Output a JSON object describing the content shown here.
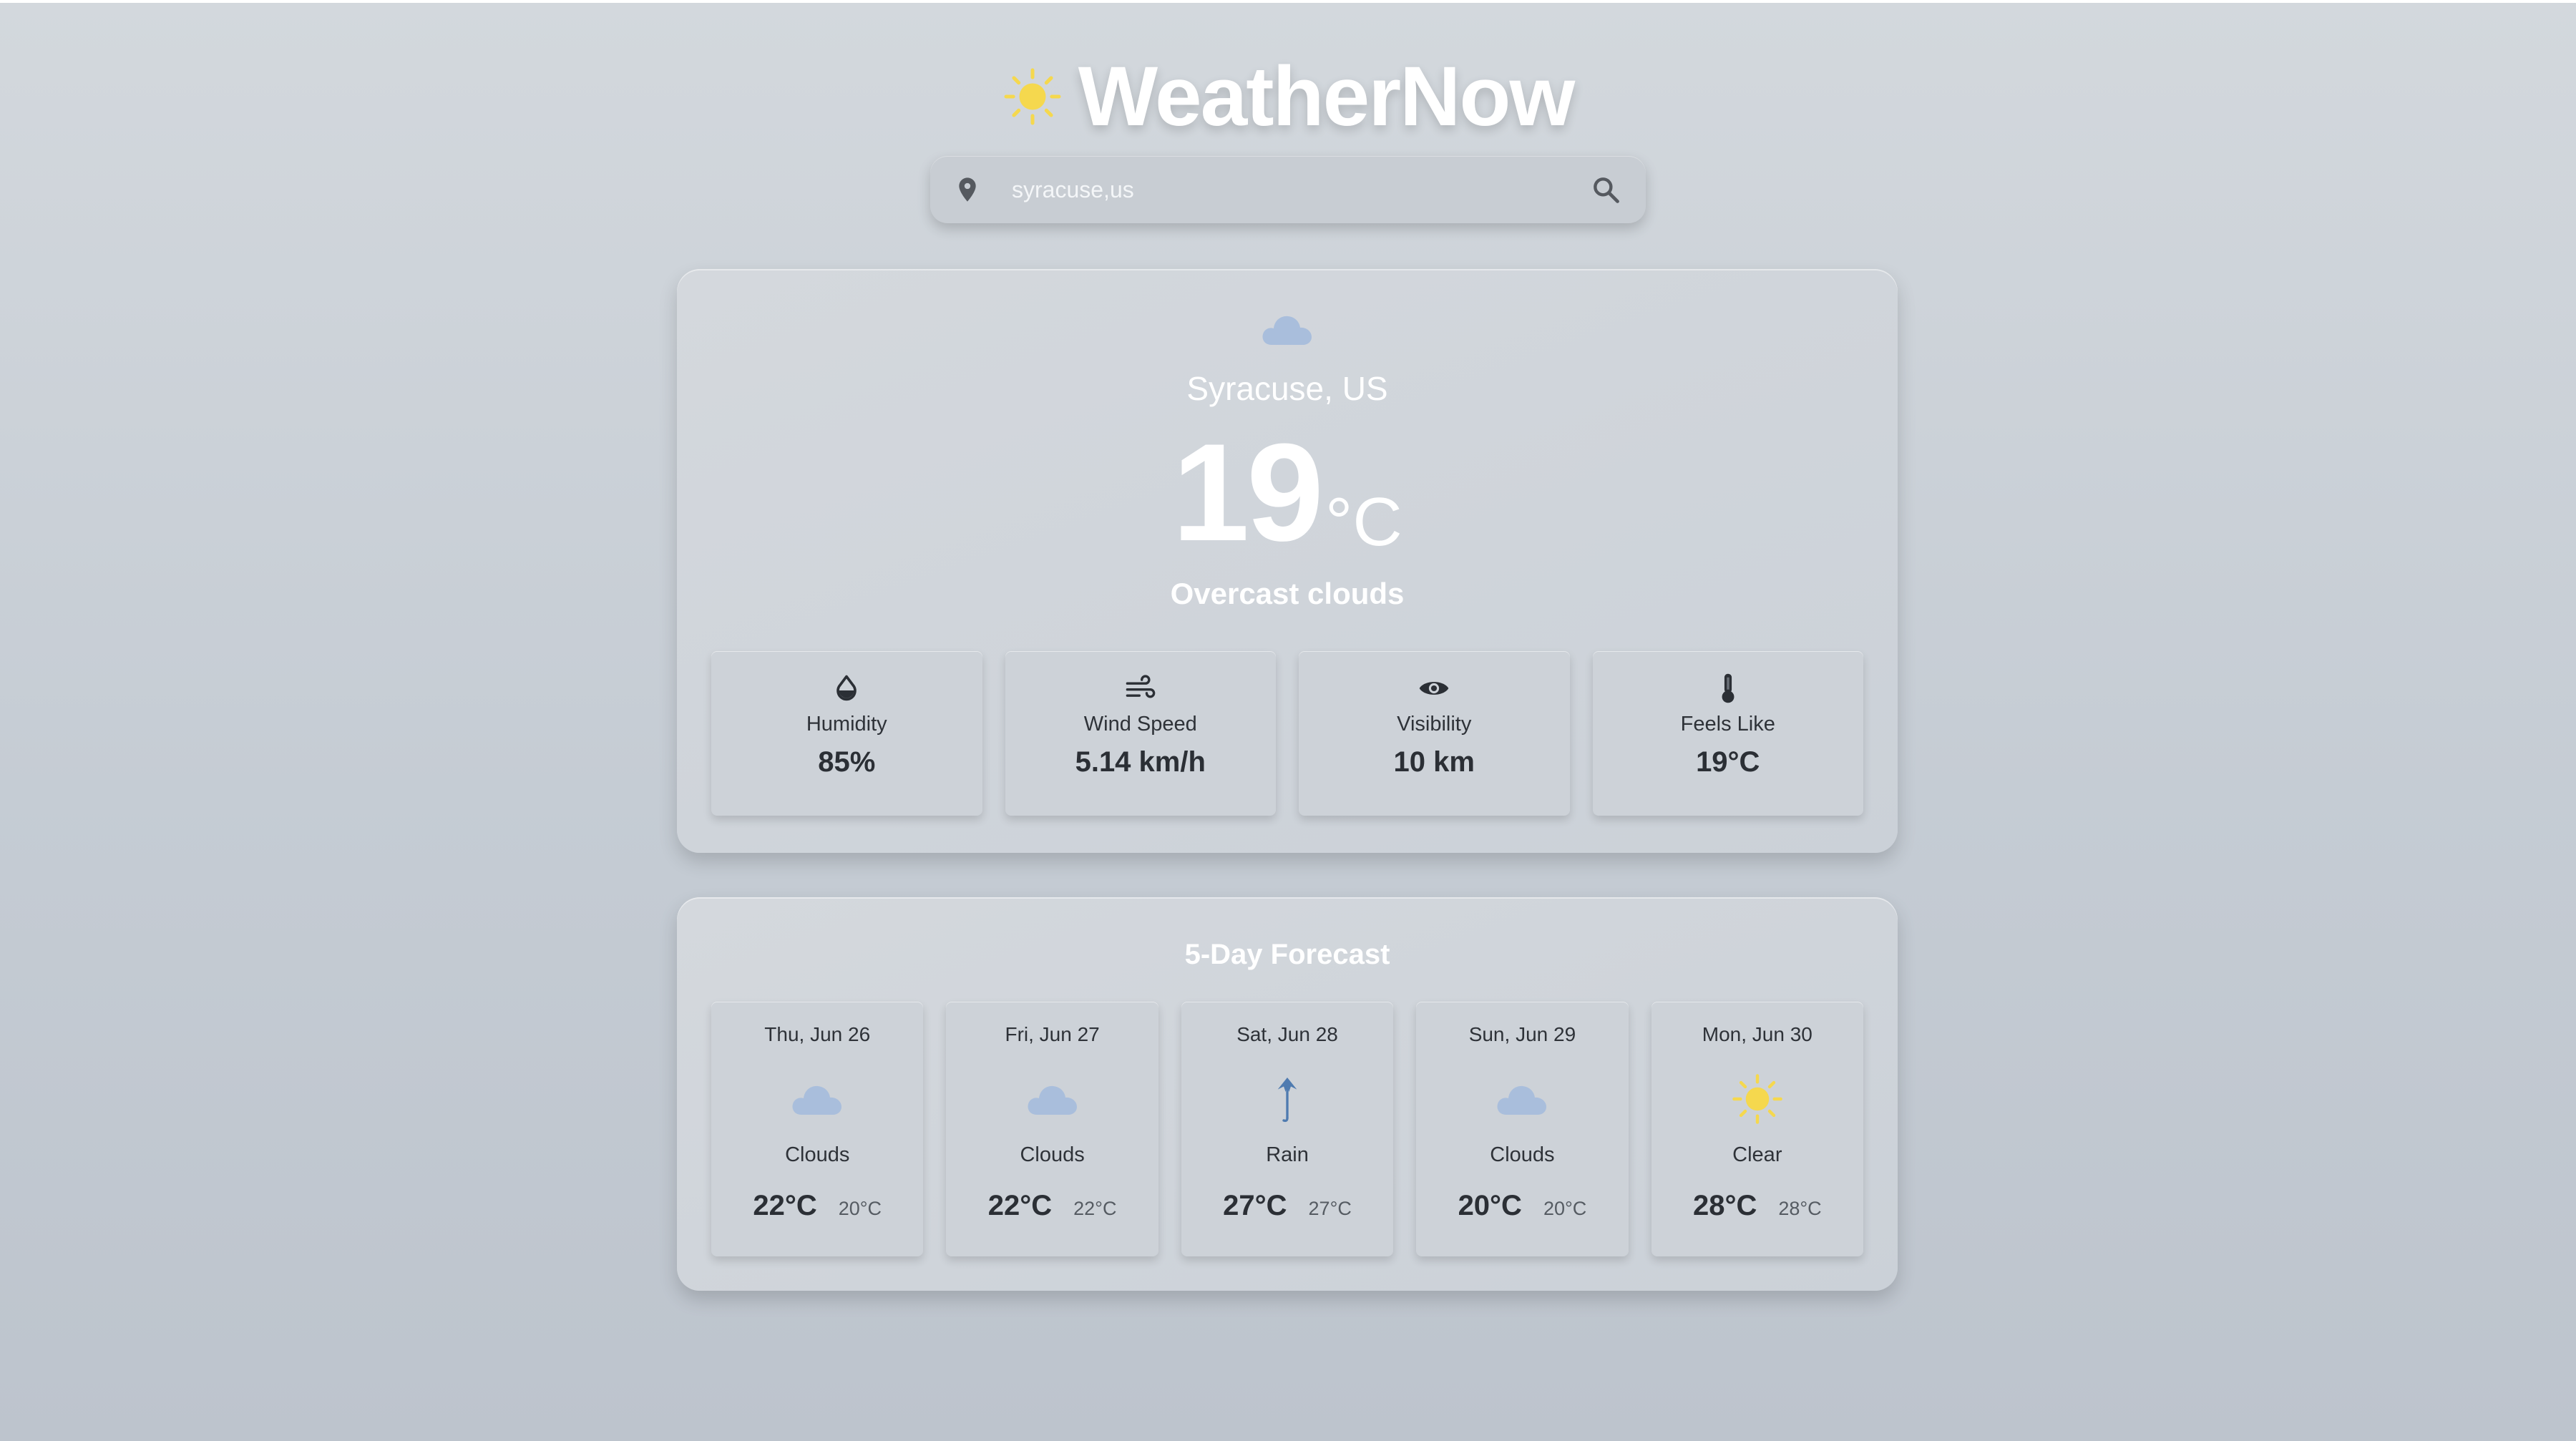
{
  "app": {
    "title": "WeatherNow",
    "logo_icon": "sun-icon"
  },
  "search": {
    "value": "syracuse,us",
    "placeholder": ""
  },
  "current": {
    "icon": "cloud-icon",
    "city": "Syracuse, US",
    "temp": "19",
    "unit": "°C",
    "condition": "Overcast clouds",
    "stats": [
      {
        "icon": "humidity-drop-icon",
        "label": "Humidity",
        "value": "85%"
      },
      {
        "icon": "wind-icon",
        "label": "Wind Speed",
        "value": "5.14 km/h"
      },
      {
        "icon": "eye-icon",
        "label": "Visibility",
        "value": "10 km"
      },
      {
        "icon": "thermometer-icon",
        "label": "Feels Like",
        "value": "19°C"
      }
    ]
  },
  "forecast": {
    "title": "5-Day Forecast",
    "days": [
      {
        "date": "Thu, Jun 26",
        "icon": "cloud-icon",
        "condition": "Clouds",
        "high": "22°C",
        "low": "20°C"
      },
      {
        "date": "Fri, Jun 27",
        "icon": "cloud-icon",
        "condition": "Clouds",
        "high": "22°C",
        "low": "22°C"
      },
      {
        "date": "Sat, Jun 28",
        "icon": "umbrella-icon",
        "condition": "Rain",
        "high": "27°C",
        "low": "27°C"
      },
      {
        "date": "Sun, Jun 29",
        "icon": "cloud-icon",
        "condition": "Clouds",
        "high": "20°C",
        "low": "20°C"
      },
      {
        "date": "Mon, Jun 30",
        "icon": "sun-icon",
        "condition": "Clear",
        "high": "28°C",
        "low": "28°C"
      }
    ]
  },
  "colors": {
    "sun": "#f5d84e",
    "cloud": "#a9bedc",
    "rain": "#4f7bb0",
    "title": "#ffffff"
  }
}
